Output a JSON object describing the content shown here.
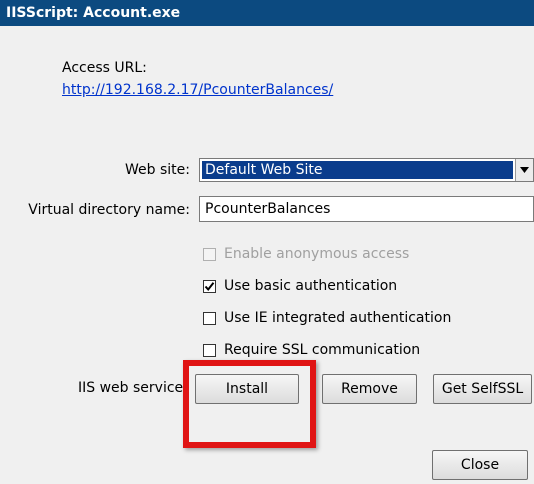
{
  "window": {
    "title": "IISScript: Account.exe"
  },
  "access": {
    "label": "Access URL:",
    "url": "http://192.168.2.17/PcounterBalances/"
  },
  "web_site": {
    "label": "Web site:",
    "value": "Default Web Site"
  },
  "virtual_directory": {
    "label": "Virtual directory name:",
    "value": "PcounterBalances"
  },
  "options": [
    {
      "label": "Enable anonymous access",
      "checked": false,
      "enabled": false
    },
    {
      "label": "Use basic authentication",
      "checked": true,
      "enabled": true
    },
    {
      "label": "Use IE integrated authentication",
      "checked": false,
      "enabled": true
    },
    {
      "label": "Require SSL communication",
      "checked": false,
      "enabled": true
    }
  ],
  "iis_service": {
    "label": "IIS web service:",
    "install_label": "Install",
    "remove_label": "Remove",
    "selfssl_label": "Get SelfSSL"
  },
  "close_label": "Close",
  "highlight_color": "#e01414"
}
